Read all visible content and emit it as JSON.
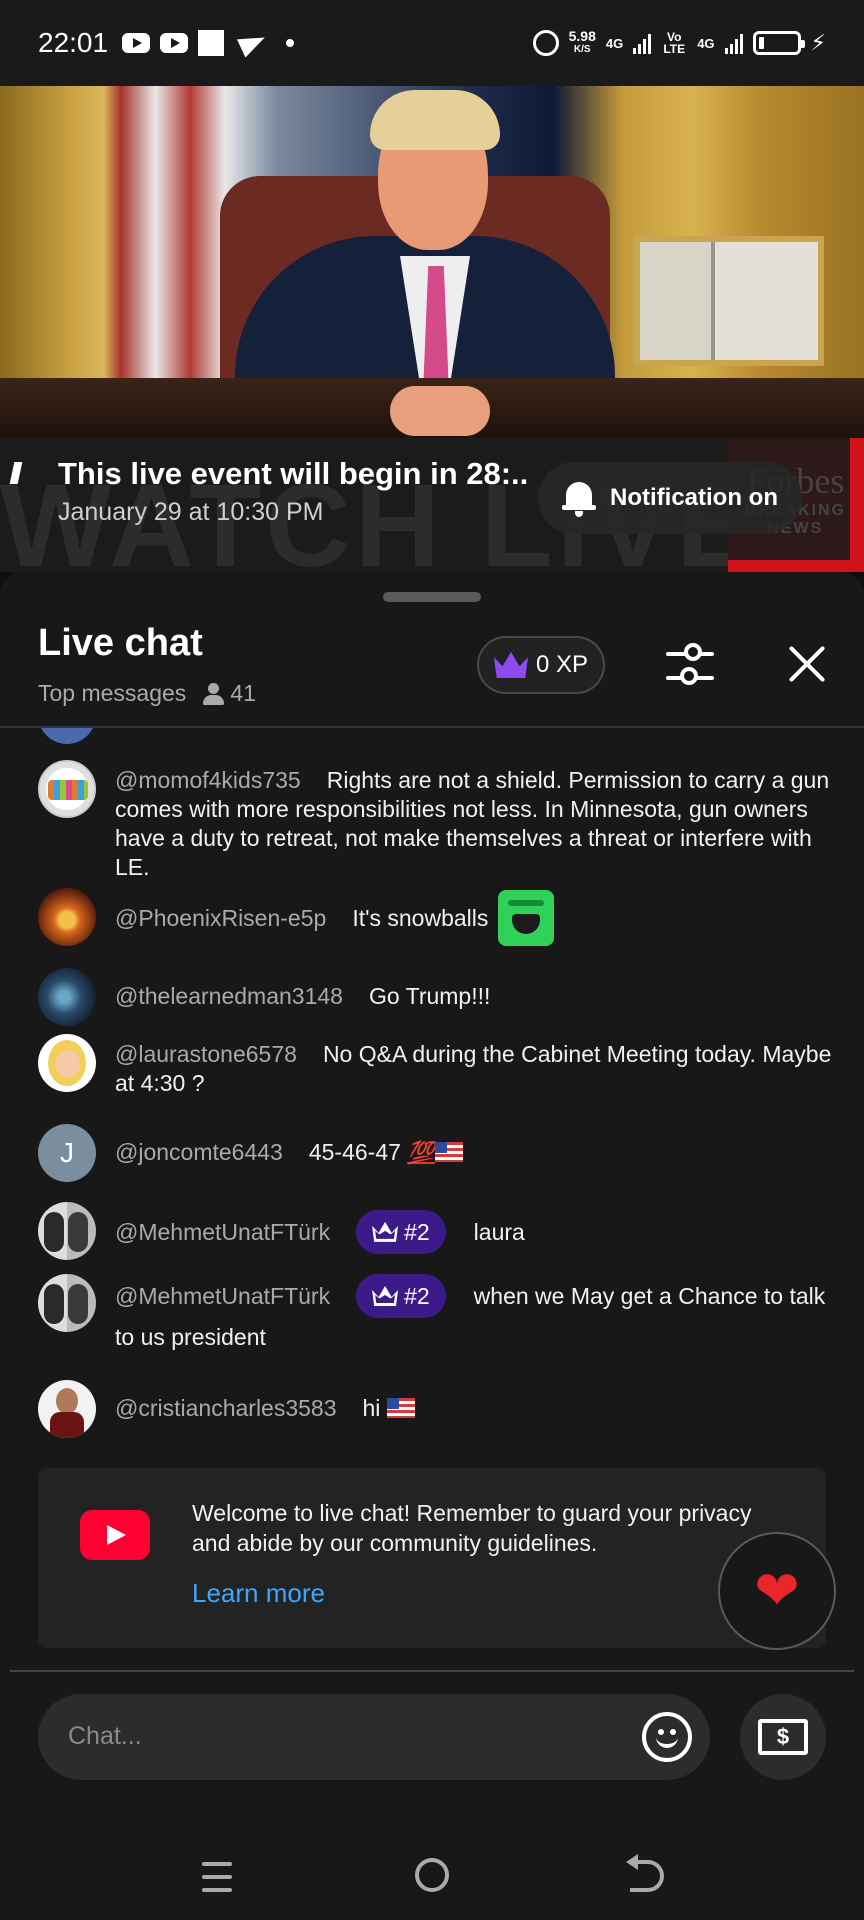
{
  "status_bar": {
    "time": "22:01",
    "speed_value": "5.98",
    "speed_unit": "K/S",
    "net1": "4G",
    "volte": "Vo LTE",
    "net2": "4G"
  },
  "video_banner": {
    "watermark": "WATCH LIVE",
    "brand_line1": "Forbes",
    "brand_line2": "BREAKING",
    "brand_line3": "NEWS",
    "title": "This live event will begin in 28:...",
    "date": "January 29 at 10:30 PM",
    "notification_label": "Notification on"
  },
  "chat_header": {
    "title": "Live chat",
    "mode": "Top messages",
    "viewer_count": "41",
    "xp_label": "0 XP"
  },
  "messages": [
    {
      "author": "@momof4kids735",
      "text": "Rights are not a shield. Permission to carry a gun comes with more responsibilities not less. In Minnesota, gun owners have a duty to retreat, not make themselves a threat or interfere with LE."
    },
    {
      "author": "@PhoenixRisen-e5p",
      "text": "It's snowballs"
    },
    {
      "author": "@thelearnedman3148",
      "text": "Go Trump!!!"
    },
    {
      "author": "@laurastone6578",
      "text": "No Q&A during the Cabinet Meeting today. Maybe at 4:30 ?"
    },
    {
      "author": "@joncomte6443",
      "avatar_letter": "J",
      "text": "45-46-47",
      "emoji": "💯"
    },
    {
      "author": "@MehmetUnatFTürk",
      "badge": "#2",
      "text": "laura"
    },
    {
      "author": "@MehmetUnatFTürk",
      "badge": "#2",
      "text": "when we May get a Chance to talk to us president"
    },
    {
      "author": "@cristiancharles3583",
      "text": "hi"
    }
  ],
  "welcome": {
    "text": "Welcome to live chat! Remember to guard your privacy and abide by our community guidelines.",
    "link": "Learn more"
  },
  "input": {
    "placeholder": "Chat..."
  },
  "icons": {
    "heart": "❤",
    "dollar": "$"
  },
  "colors": {
    "background": "#0f0f0f",
    "panel": "#181818",
    "link": "#3ea6ff",
    "badge": "#3d1a8a",
    "crown": "#8f4bf0",
    "youtube_red": "#ff0033"
  }
}
